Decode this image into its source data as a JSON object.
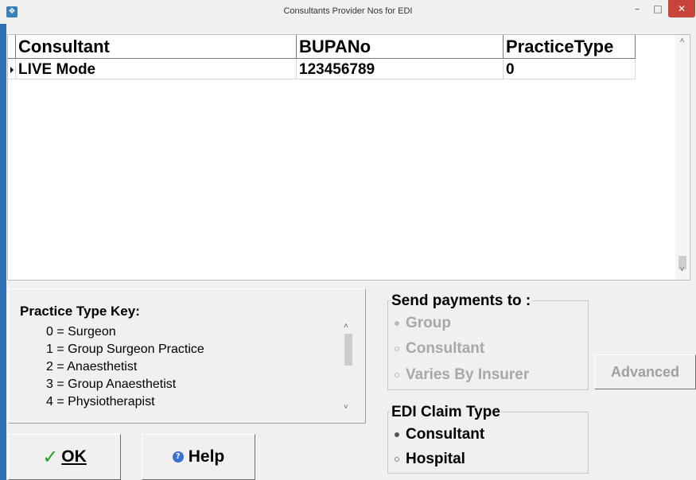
{
  "window": {
    "title": "Consultants Provider Nos for EDI",
    "icons": {
      "app": "app-icon",
      "minimize": "minimize-icon",
      "maximize": "maximize-icon",
      "close": "close-icon"
    }
  },
  "grid": {
    "columns": [
      "Consultant",
      "BUPANo",
      "PracticeType"
    ],
    "rows": [
      {
        "consultant": "LIVE Mode",
        "bupano": "123456789",
        "practice_type": "0"
      }
    ]
  },
  "practice_key": {
    "title": "Practice Type Key:",
    "items": [
      "0 = Surgeon",
      "1 = Group Surgeon Practice",
      "2 = Anaesthetist",
      "3 = Group Anaesthetist",
      "4 = Physiotherapist"
    ]
  },
  "send_payments": {
    "legend": "Send payments to :",
    "options": [
      "Group",
      "Consultant",
      "Varies By Insurer"
    ],
    "selected": "Group",
    "enabled": false
  },
  "edi_claim": {
    "legend": "EDI Claim Type",
    "options": [
      "Consultant",
      "Hospital"
    ],
    "selected": "Consultant"
  },
  "buttons": {
    "advanced": "Advanced",
    "ok": "OK",
    "help": "Help"
  }
}
